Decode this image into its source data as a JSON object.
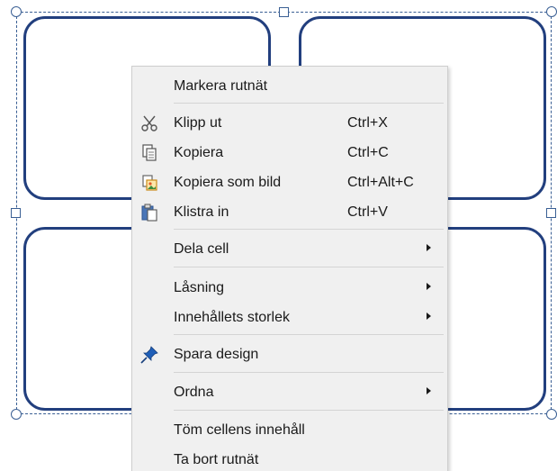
{
  "menu": {
    "items": [
      {
        "label": "Markera rutnät",
        "shortcut": "",
        "icon": ""
      },
      {
        "label": "Klipp ut",
        "shortcut": "Ctrl+X",
        "icon": "scissors-icon"
      },
      {
        "label": "Kopiera",
        "shortcut": "Ctrl+C",
        "icon": "copy-icon"
      },
      {
        "label": "Kopiera som bild",
        "shortcut": "Ctrl+Alt+C",
        "icon": "copy-image-icon"
      },
      {
        "label": "Klistra in",
        "shortcut": "Ctrl+V",
        "icon": "paste-icon"
      },
      {
        "label": "Dela cell",
        "shortcut": "",
        "icon": "",
        "submenu": true
      },
      {
        "label": "Låsning",
        "shortcut": "",
        "icon": "",
        "submenu": true
      },
      {
        "label": "Innehållets storlek",
        "shortcut": "",
        "icon": "",
        "submenu": true
      },
      {
        "label": "Spara design",
        "shortcut": "",
        "icon": "pin-icon"
      },
      {
        "label": "Ordna",
        "shortcut": "",
        "icon": "",
        "submenu": true
      },
      {
        "label": "Töm cellens innehåll",
        "shortcut": "",
        "icon": ""
      },
      {
        "label": "Ta bort rutnät",
        "shortcut": "",
        "icon": ""
      }
    ]
  },
  "colors": {
    "cell_border": "#223f7e",
    "selection": "#3a5f94",
    "menu_background": "#f0f0f0",
    "pin_icon": "#1f5fb8"
  }
}
